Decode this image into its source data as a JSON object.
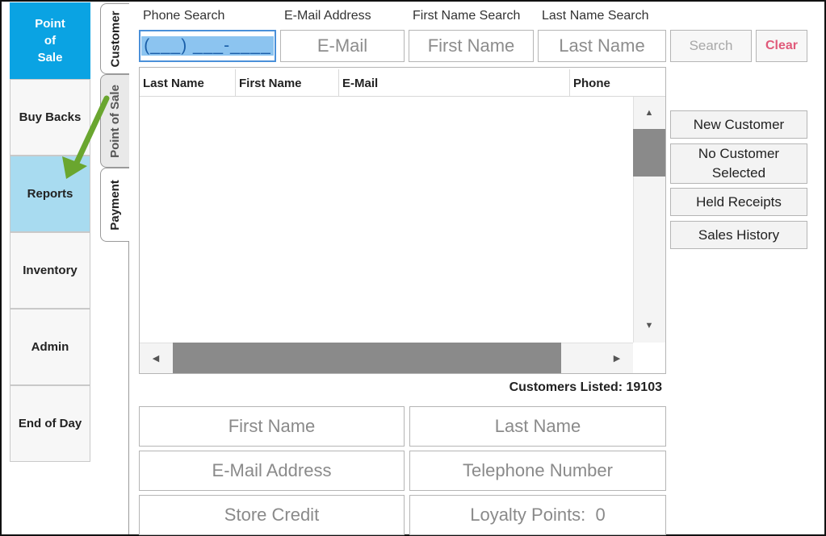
{
  "nav": {
    "items": [
      {
        "label": "Point\nof\nSale"
      },
      {
        "label": "Buy Backs"
      },
      {
        "label": "Reports"
      },
      {
        "label": "Inventory"
      },
      {
        "label": "Admin"
      },
      {
        "label": "End of Day"
      }
    ]
  },
  "tabs": [
    "Customer",
    "Point of Sale",
    "Payment"
  ],
  "search": {
    "phone_label": "Phone Search",
    "email_label": "E-Mail Address",
    "first_label": "First Name Search",
    "last_label": "Last Name Search",
    "phone_value": "(___) ___-____",
    "email_placeholder": "E-Mail",
    "first_placeholder": "First Name",
    "last_placeholder": "Last Name",
    "search_button": "Search",
    "clear_button": "Clear"
  },
  "table": {
    "columns": [
      "Last Name",
      "First Name",
      "E-Mail",
      "Phone"
    ]
  },
  "actions": {
    "new_customer": "New Customer",
    "no_customer": "No Customer Selected",
    "held_receipts": "Held Receipts",
    "sales_history": "Sales History"
  },
  "customers_listed": "Customers Listed: 19103",
  "details": {
    "first_name": "First Name",
    "last_name": "Last Name",
    "email": "E-Mail Address",
    "telephone": "Telephone Number",
    "store_credit": "Store Credit",
    "loyalty_points": "Loyalty Points:  0"
  },
  "colors": {
    "accent": "#0aa3e3",
    "highlight": "#a8dbf0",
    "clear": "#e05a7a",
    "arrow": "#6aa62f",
    "scroll_thumb": "#8a8a8a"
  }
}
